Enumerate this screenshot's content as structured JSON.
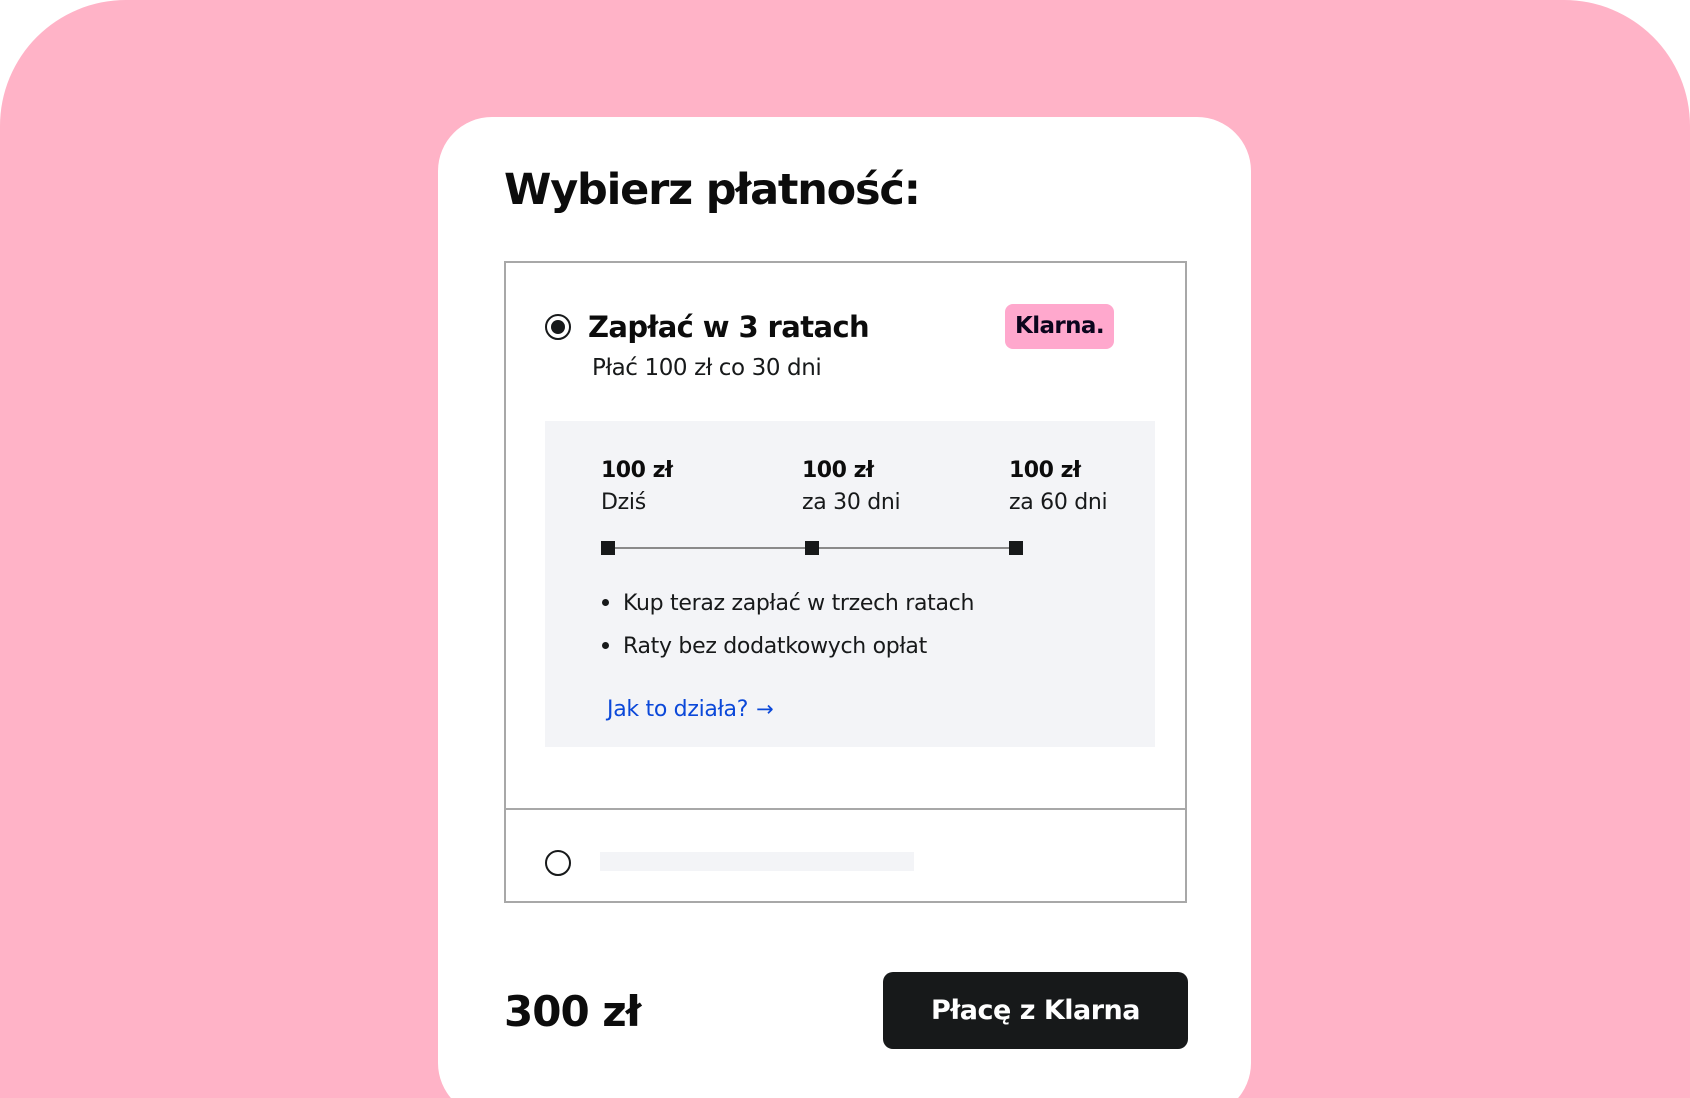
{
  "card": {
    "title": "Wybierz płatność:"
  },
  "option_installments": {
    "title": "Zapłać w 3 ratach",
    "subtitle": "Płać 100 zł co 30 dni",
    "badge": "Klarna.",
    "selected": true,
    "schedule": [
      {
        "amount": "100 zł",
        "when": "Dziś"
      },
      {
        "amount": "100 zł",
        "when": "za 30 dni"
      },
      {
        "amount": "100 zł",
        "when": "za 60 dni"
      }
    ],
    "bullets": [
      "Kup teraz zapłać w trzech ratach",
      "Raty bez dodatkowych opłat"
    ],
    "link_label": "Jak to działa?",
    "link_arrow": "→"
  },
  "option_other": {
    "selected": false
  },
  "footer": {
    "total": "300 zł",
    "pay_button_label": "Płacę z Klarna"
  },
  "colors": {
    "background": "#ffb3c7",
    "badge": "#ffa8cd",
    "button": "#17191a",
    "link": "#0b48d9"
  }
}
